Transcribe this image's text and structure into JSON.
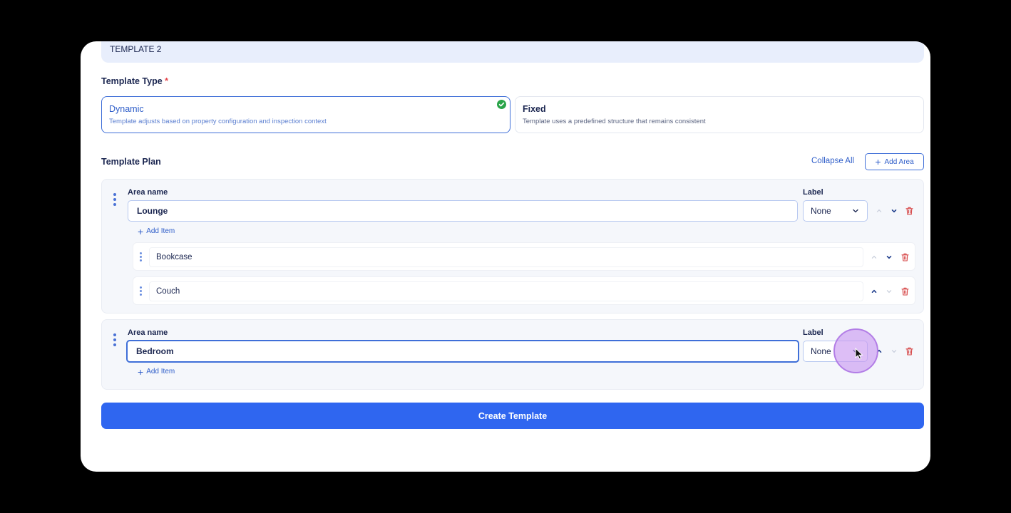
{
  "template_name": "TEMPLATE 2",
  "template_type": {
    "label": "Template Type",
    "required_mark": "*",
    "options": [
      {
        "title": "Dynamic",
        "description": "Template adjusts based on property configuration and inspection context",
        "selected": true
      },
      {
        "title": "Fixed",
        "description": "Template uses a predefined structure that remains consistent",
        "selected": false
      }
    ]
  },
  "template_plan": {
    "label": "Template Plan",
    "collapse_all": "Collapse All",
    "add_area": "Add Area",
    "areas": [
      {
        "area_label": "Area name",
        "name": "Lounge",
        "label_field": "Label",
        "label_value": "None",
        "add_item": "Add Item",
        "items": [
          "Bookcase",
          "Couch"
        ]
      },
      {
        "area_label": "Area name",
        "name": "Bedroom",
        "label_field": "Label",
        "label_value": "None",
        "add_item": "Add Item",
        "items": []
      }
    ]
  },
  "create_button": "Create Template",
  "colors": {
    "primary": "#2f66f0",
    "accent_border": "#3f6fd8",
    "success": "#2aa449",
    "danger": "#d64545",
    "highlight_halo": "#c896f0"
  },
  "icons": [
    "check-circle-icon",
    "plus-icon",
    "drag-handle-icon",
    "chevron-down-icon",
    "chevron-up-icon",
    "trash-icon",
    "mouse-cursor-icon"
  ]
}
